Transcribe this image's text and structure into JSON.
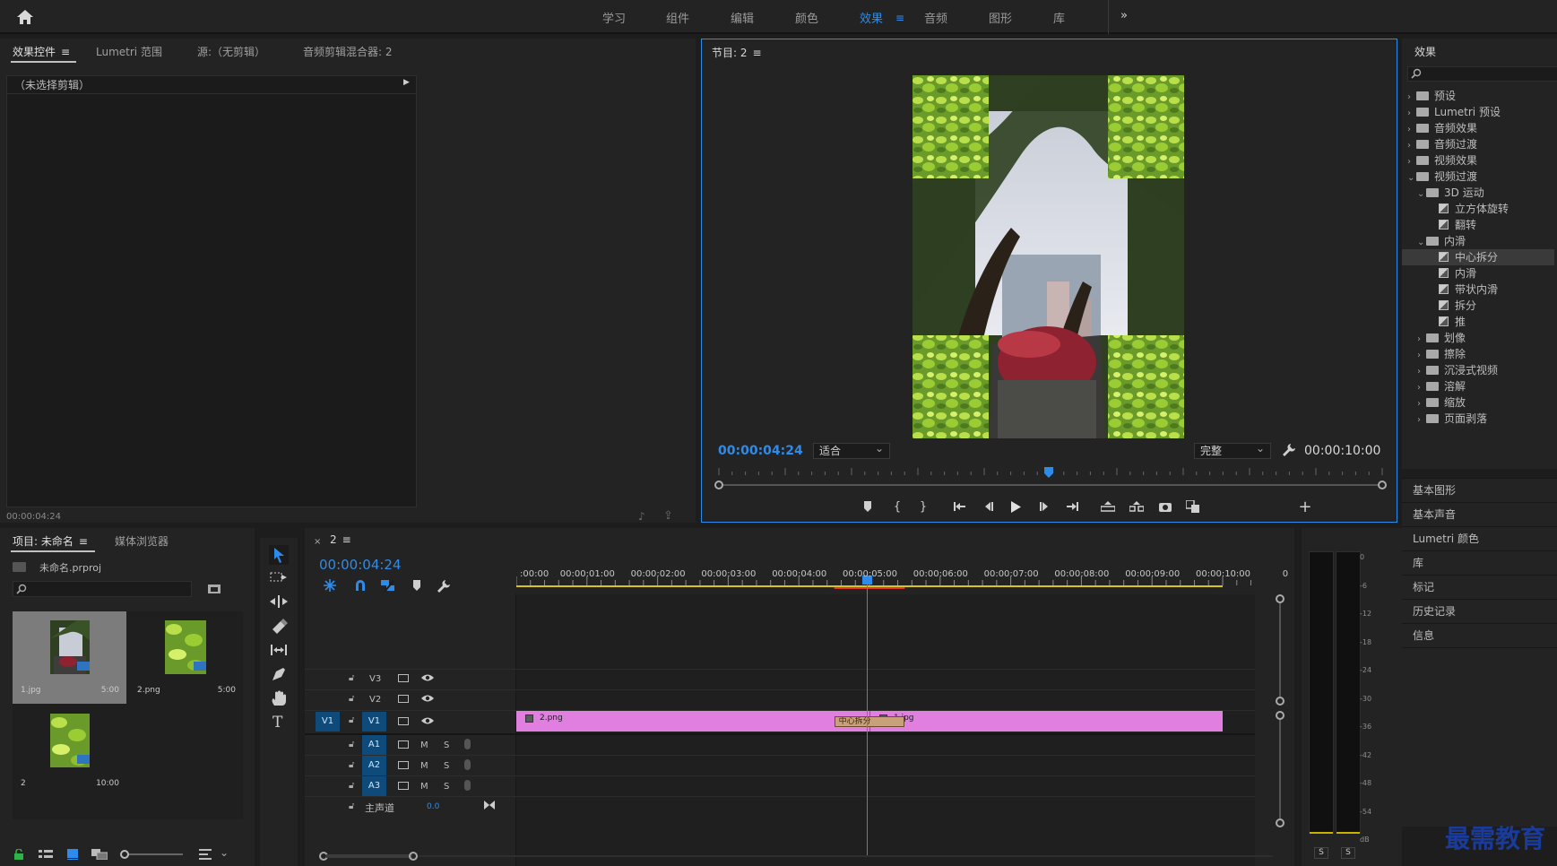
{
  "workspaces": [
    "学习",
    "组件",
    "编辑",
    "颜色",
    "效果",
    "音频",
    "图形",
    "库"
  ],
  "active_workspace": "效果",
  "more_glyph": "»",
  "effect_controls": {
    "tabs": [
      "效果控件",
      "Lumetri 范围",
      "源:（无剪辑）",
      "音频剪辑混合器: 2"
    ],
    "no_clip": "（未选择剪辑）",
    "timecode": "00:00:04:24"
  },
  "program": {
    "title": "节目: 2",
    "timecode": "00:00:04:24",
    "fit": "适合",
    "quality": "完整",
    "duration": "00:00:10:00",
    "playhead_fraction": 0.4975
  },
  "effects_panel": {
    "title": "效果",
    "tree": [
      {
        "label": "预设",
        "type": "folder",
        "level": 0,
        "expanded": false
      },
      {
        "label": "Lumetri 预设",
        "type": "folder",
        "level": 0,
        "expanded": false
      },
      {
        "label": "音频效果",
        "type": "folder",
        "level": 0,
        "expanded": false
      },
      {
        "label": "音频过渡",
        "type": "folder",
        "level": 0,
        "expanded": false
      },
      {
        "label": "视频效果",
        "type": "folder",
        "level": 0,
        "expanded": false
      },
      {
        "label": "视频过渡",
        "type": "folder",
        "level": 0,
        "expanded": true
      },
      {
        "label": "3D 运动",
        "type": "folder",
        "level": 1,
        "expanded": true
      },
      {
        "label": "立方体旋转",
        "type": "fx",
        "level": 2
      },
      {
        "label": "翻转",
        "type": "fx",
        "level": 2
      },
      {
        "label": "内滑",
        "type": "folder",
        "level": 1,
        "expanded": true
      },
      {
        "label": "中心拆分",
        "type": "fx",
        "level": 2,
        "selected": true
      },
      {
        "label": "内滑",
        "type": "fx",
        "level": 2
      },
      {
        "label": "带状内滑",
        "type": "fx",
        "level": 2
      },
      {
        "label": "拆分",
        "type": "fx",
        "level": 2
      },
      {
        "label": "推",
        "type": "fx",
        "level": 2
      },
      {
        "label": "划像",
        "type": "folder",
        "level": 1,
        "expanded": false
      },
      {
        "label": "擦除",
        "type": "folder",
        "level": 1,
        "expanded": false
      },
      {
        "label": "沉浸式视频",
        "type": "folder",
        "level": 1,
        "expanded": false
      },
      {
        "label": "溶解",
        "type": "folder",
        "level": 1,
        "expanded": false
      },
      {
        "label": "缩放",
        "type": "folder",
        "level": 1,
        "expanded": false
      },
      {
        "label": "页面剥落",
        "type": "folder",
        "level": 1,
        "expanded": false
      }
    ],
    "side_panels": [
      "基本图形",
      "基本声音",
      "Lumetri 颜色",
      "库",
      "标记",
      "历史记录",
      "信息"
    ]
  },
  "project": {
    "tabs": [
      "项目: 未命名",
      "媒体浏览器"
    ],
    "file": "未命名.prproj",
    "items": [
      {
        "name": "1.jpg",
        "duration": "5:00",
        "selected": true
      },
      {
        "name": "2.png",
        "duration": "5:00",
        "selected": false
      },
      {
        "name": "2",
        "duration": "10:00",
        "selected": false
      }
    ]
  },
  "timeline": {
    "tab": "2",
    "timecode": "00:00:04:24",
    "ruler": [
      ":00:00",
      "00:00:01:00",
      "00:00:02:00",
      "00:00:03:00",
      "00:00:04:00",
      "00:00:05:00",
      "00:00:06:00",
      "00:00:07:00",
      "00:00:08:00",
      "00:00:09:00",
      "00:00:10:00",
      "0"
    ],
    "video_tracks": [
      "V3",
      "V2",
      "V1"
    ],
    "source_patch": "V1",
    "audio_tracks": [
      "A1",
      "A2",
      "A3"
    ],
    "mute": "M",
    "solo": "S",
    "master_label": "主声道",
    "master_value": "0.0",
    "clips": [
      {
        "name": "2.png",
        "track": "V1",
        "start": 0.0,
        "end": 5.0
      },
      {
        "name": "1.jpg",
        "track": "V1",
        "start": 5.0,
        "end": 10.0
      }
    ],
    "transition": {
      "name": "中心拆分",
      "start": 4.5,
      "end": 5.5
    },
    "playhead": 4.96,
    "duration": 10
  },
  "meter": {
    "db_labels": [
      "0",
      "-6",
      "-12",
      "-18",
      "-24",
      "-30",
      "-36",
      "-42",
      "-48",
      "-54",
      "dB"
    ],
    "solo_buttons": [
      "S",
      "S"
    ]
  },
  "watermark": "最需教育"
}
